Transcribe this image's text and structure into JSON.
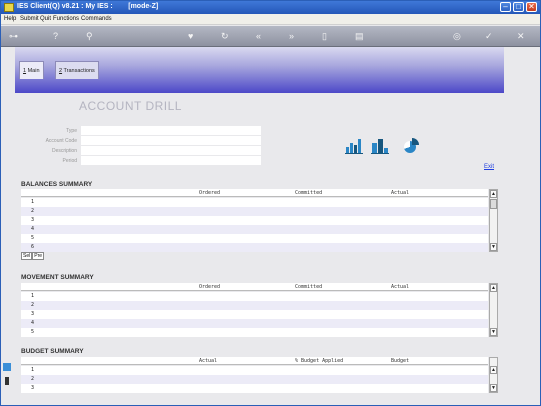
{
  "window": {
    "title": "IES Client(Q) v8.21 : My IES :        [mode-Z]",
    "minimize": "–",
    "maximize": "□",
    "close": "✕"
  },
  "menu": [
    "Help",
    "Submit",
    "Quit",
    "Functions",
    "Commands"
  ],
  "toolbar": {
    "icons": [
      {
        "name": "key-icon",
        "glyph": "⊶"
      },
      {
        "name": "help-icon",
        "glyph": "?"
      },
      {
        "name": "search-icon",
        "glyph": "⚲"
      },
      {
        "name": "favorite-icon",
        "glyph": "♥"
      },
      {
        "name": "refresh-icon",
        "glyph": "↻"
      },
      {
        "name": "back-icon",
        "glyph": "«"
      },
      {
        "name": "forward-icon",
        "glyph": "»"
      },
      {
        "name": "clipboard-icon",
        "glyph": "▯"
      },
      {
        "name": "list-icon",
        "glyph": "▤"
      },
      {
        "name": "globe-icon",
        "glyph": "◎"
      },
      {
        "name": "confirm-icon",
        "glyph": "✓"
      },
      {
        "name": "cancel-icon",
        "glyph": "✕"
      }
    ]
  },
  "tabs": [
    {
      "key": "1",
      "label": " Main"
    },
    {
      "key": "2",
      "label": " Transactions"
    }
  ],
  "page": {
    "title": "ACCOUNT DRILL",
    "fields": [
      {
        "label": "Type",
        "value": ""
      },
      {
        "label": "Account Code",
        "value": ""
      },
      {
        "label": "Description",
        "value": ""
      },
      {
        "label": "Period",
        "value": ""
      }
    ],
    "exit_label": "Exit"
  },
  "balances": {
    "title": "BALANCES SUMMARY",
    "columns": [
      "Ordered",
      "Committed",
      "Actual"
    ],
    "rows": [
      "1",
      "2",
      "3",
      "4",
      "5",
      "6"
    ],
    "hscroll": [
      "Sel",
      "Pre"
    ]
  },
  "movement": {
    "title": "MOVEMENT SUMMARY",
    "columns": [
      "Ordered",
      "Committed",
      "Actual"
    ],
    "rows": [
      "1",
      "2",
      "3",
      "4",
      "5"
    ]
  },
  "budget": {
    "title": "BUDGET SUMMARY",
    "columns": [
      "Actual",
      "% Budget Applied",
      "Budget"
    ],
    "rows": [
      "1",
      "2",
      "3"
    ]
  },
  "colors": {
    "titlebar": "#2457b8",
    "tab_band_dark": "#4c48c8",
    "chart_blue": "#2a86c6",
    "link": "#1f3ee0"
  }
}
